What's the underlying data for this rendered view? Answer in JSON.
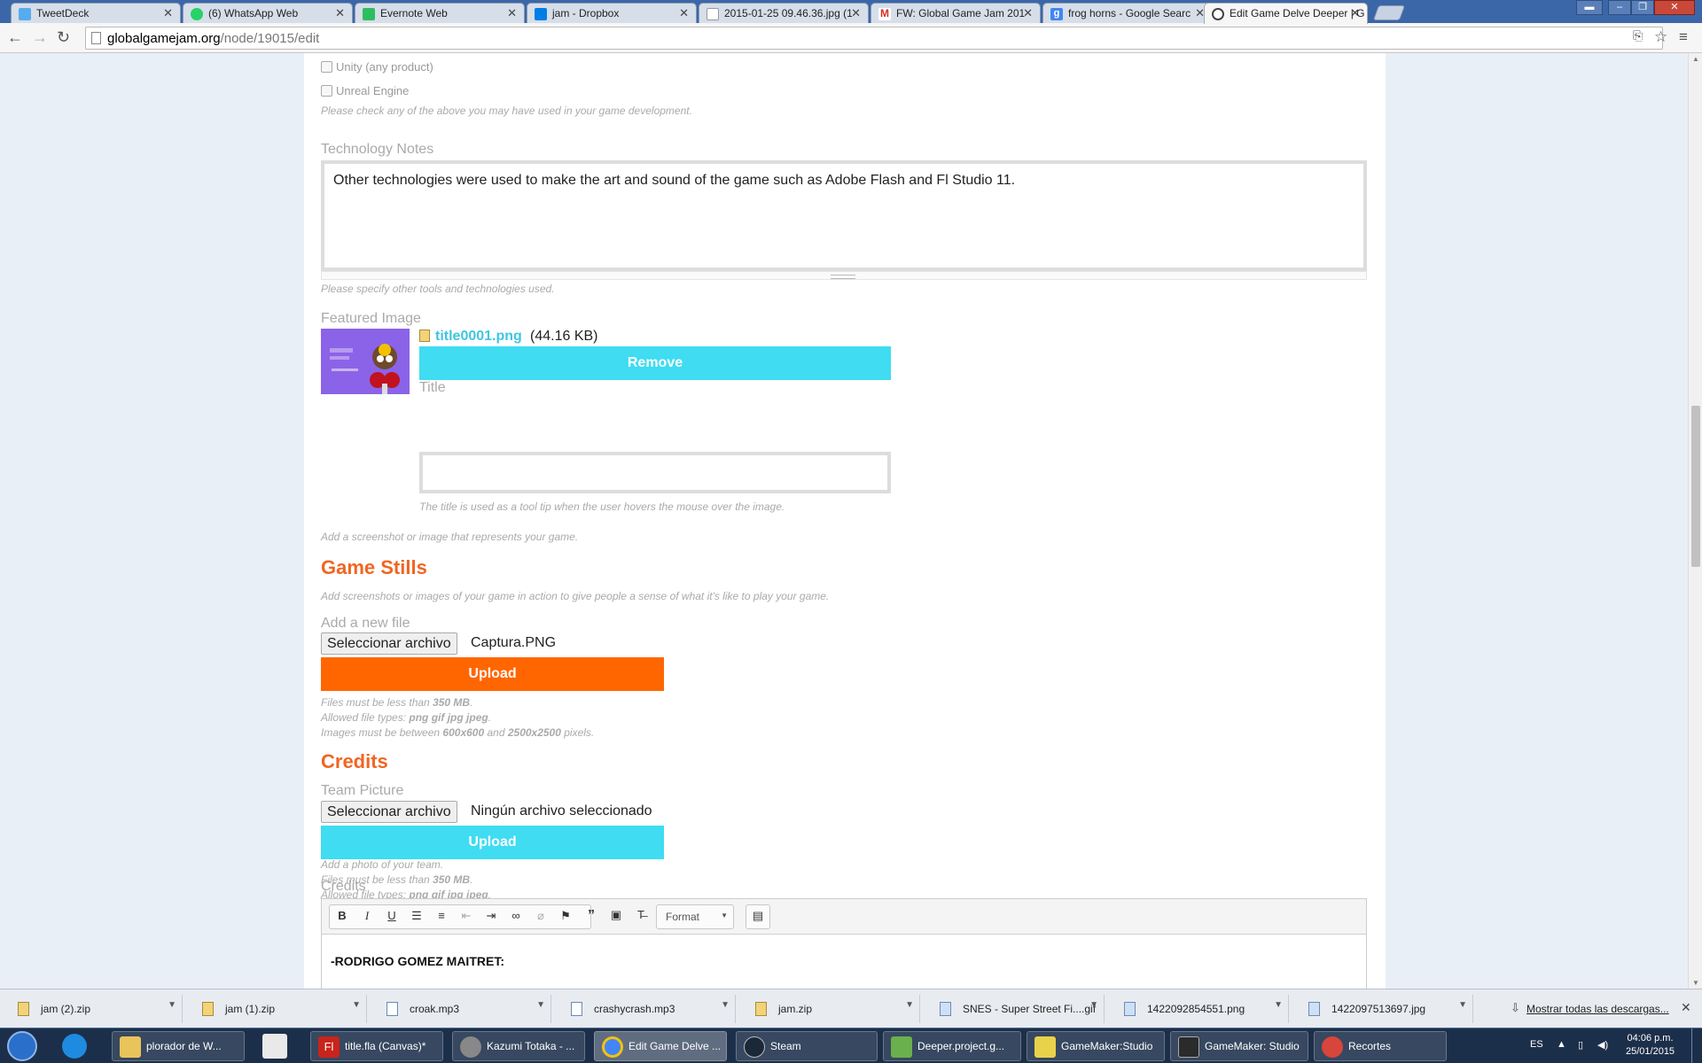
{
  "tabs": [
    {
      "label": "TweetDeck",
      "color": "#55acee"
    },
    {
      "label": "(6) WhatsApp Web",
      "color": "#25d366"
    },
    {
      "label": "Evernote Web",
      "color": "#2dbe60"
    },
    {
      "label": "jam - Dropbox",
      "color": "#007ee5"
    },
    {
      "label": "2015-01-25 09.46.36.jpg (1",
      "color": "#cccccc"
    },
    {
      "label": "FW: Global Game Jam 201",
      "color": "#d93025"
    },
    {
      "label": "frog horns - Google Searc",
      "color": "#4285f4"
    },
    {
      "label": "Edit Game Delve Deeper | G",
      "color": "#444444"
    }
  ],
  "address": {
    "domain": "globalgamejam.org",
    "path": "/node/19015/edit"
  },
  "form": {
    "checkbox_unity": "Unity (any product)",
    "checkbox_unreal": "Unreal Engine",
    "tech_help": "Please check any of the above you may have used in your game development.",
    "tech_notes_label": "Technology Notes",
    "tech_notes_value": "Other technologies were used to make the art and sound of the game such as Adobe Flash and Fl Studio 11.",
    "tech_notes_help": "Please specify other tools and technologies used.",
    "featured_label": "Featured Image",
    "featured_file": "title0001.png",
    "featured_size": "(44.16 KB)",
    "remove_label": "Remove",
    "title_label": "Title",
    "title_help": "The title is used as a tool tip when the user hovers the mouse over the image.",
    "featured_help": "Add a screenshot or image that represents your game.",
    "game_stills_heading": "Game Stills",
    "game_stills_help": "Add screenshots or images of your game in action to give people a sense of what it's like to play your game.",
    "add_file_label": "Add a new file",
    "choose_file_label": "Seleccionar archivo",
    "stills_chosen_file": "Captura.PNG",
    "upload_label": "Upload",
    "files_less_prefix": "Files must be less than ",
    "files_less_size": "350 MB",
    "allowed_prefix": "Allowed file types: ",
    "allowed_types": "png gif jpg jpeg",
    "images_between_prefix": "Images must be between ",
    "images_between_min": "600x600",
    "images_between_and": " and ",
    "images_between_max": "2500x2500",
    "images_between_suffix": " pixels.",
    "period": ".",
    "credits_heading": "Credits",
    "team_picture_label": "Team Picture",
    "team_chosen_file": "Ningún archivo seleccionado",
    "team_photo_help": "Add a photo of your team.",
    "credits_field_label": "Credits",
    "format_label": "Format",
    "credits_content": "-RODRIGO GOMEZ MAITRET:"
  },
  "downloads": {
    "items": [
      "jam (2).zip",
      "jam (1).zip",
      "croak.mp3",
      "crashycrash.mp3",
      "jam.zip",
      "SNES - Super Street Fi....gif",
      "1422092854551.png",
      "1422097513697.jpg"
    ],
    "show_all": "Mostrar todas las descargas..."
  },
  "taskbar": {
    "items": [
      "plorador de W...",
      "title.fla (Canvas)*",
      "Kazumi Totaka - ...",
      "Edit Game Delve ...",
      "Steam",
      "Deeper.project.g...",
      "GameMaker:Studio",
      "GameMaker: Studio",
      "Recortes"
    ],
    "lang": "ES",
    "time": "04:06 p.m.",
    "date": "25/01/2015"
  },
  "colors": {
    "accent_orange": "#f26522",
    "upload_orange": "#ff6600",
    "cyan_button": "#3fdcf2"
  }
}
